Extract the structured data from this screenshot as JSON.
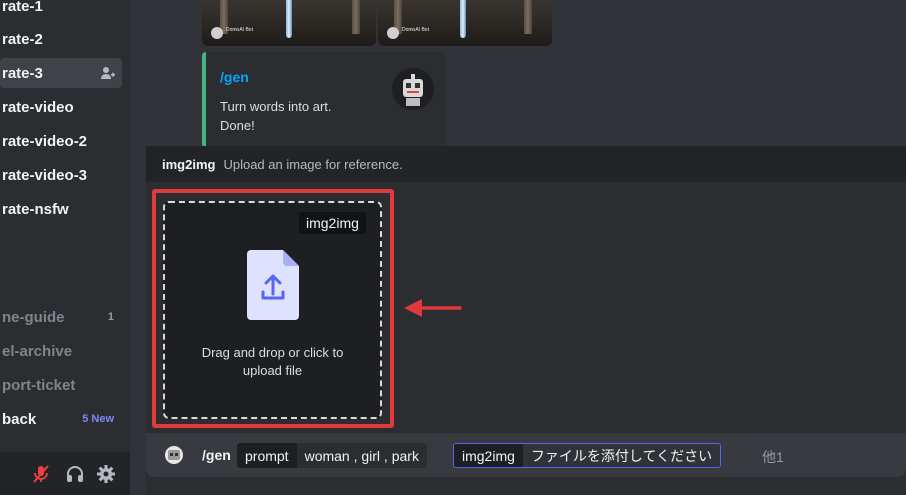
{
  "sidebar": {
    "channels": [
      {
        "label": "rate-1"
      },
      {
        "label": "rate-2"
      },
      {
        "label": "rate-3"
      },
      {
        "label": "rate-video"
      },
      {
        "label": "rate-video-2"
      },
      {
        "label": "rate-video-3"
      },
      {
        "label": "rate-nsfw"
      }
    ],
    "other_channels": [
      {
        "label": "ne-guide",
        "count": "1"
      },
      {
        "label": "el-archive"
      },
      {
        "label": "port-ticket"
      },
      {
        "label": "back",
        "badge": "5 New"
      }
    ]
  },
  "chat": {
    "image_attribution": "DomoAI Bot",
    "embed": {
      "title": "/gen",
      "line1": "Turn words into art.",
      "line2": "Done!"
    }
  },
  "option_panel": {
    "name": "img2img",
    "description": "Upload an image for reference.",
    "dropzone_tag": "img2img",
    "dropzone_line1": "Drag and drop or click to",
    "dropzone_line2": "upload file"
  },
  "command_bar": {
    "command": "/gen",
    "prompt_key": "prompt",
    "prompt_value": "woman , girl , park",
    "img_key": "img2img",
    "img_value": "ファイルを添付してください",
    "more": "他1"
  },
  "colors": {
    "accent_link": "#00a8fc",
    "embed_bar": "#43b581",
    "highlight": "#e03a3a",
    "brand": "#5865f2"
  }
}
